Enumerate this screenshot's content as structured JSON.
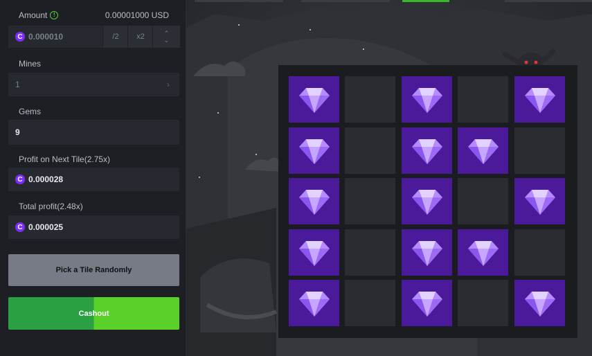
{
  "amount": {
    "label": "Amount",
    "info_icon": "info-icon",
    "usd": "0.00001000 USD",
    "value": "0.000010",
    "half": "/2",
    "double": "x2"
  },
  "mines": {
    "label": "Mines",
    "value": "1"
  },
  "gems": {
    "label": "Gems",
    "value": "9"
  },
  "profit_next": {
    "label": "Profit on Next Tile(2.75x)",
    "value": "0.000028"
  },
  "total_profit": {
    "label": "Total profit(2.48x)",
    "value": "0.000025"
  },
  "buttons": {
    "pick_random": "Pick a Tile Randomly",
    "cashout": "Cashout"
  },
  "coin_symbol": "C",
  "board": {
    "rows": [
      [
        "gem",
        "empty",
        "gem",
        "empty",
        "gem"
      ],
      [
        "gem",
        "empty",
        "gem",
        "gem",
        "empty"
      ],
      [
        "gem",
        "empty",
        "gem",
        "empty",
        "gem"
      ],
      [
        "gem",
        "empty",
        "gem",
        "gem",
        "empty"
      ],
      [
        "gem",
        "empty",
        "gem",
        "empty",
        "gem"
      ]
    ]
  },
  "colors": {
    "gem_tile": "#4a1a9a",
    "empty_tile": "#2a2c31",
    "cashout_green": "#5ad12a",
    "coin": "#7b2ff7"
  }
}
